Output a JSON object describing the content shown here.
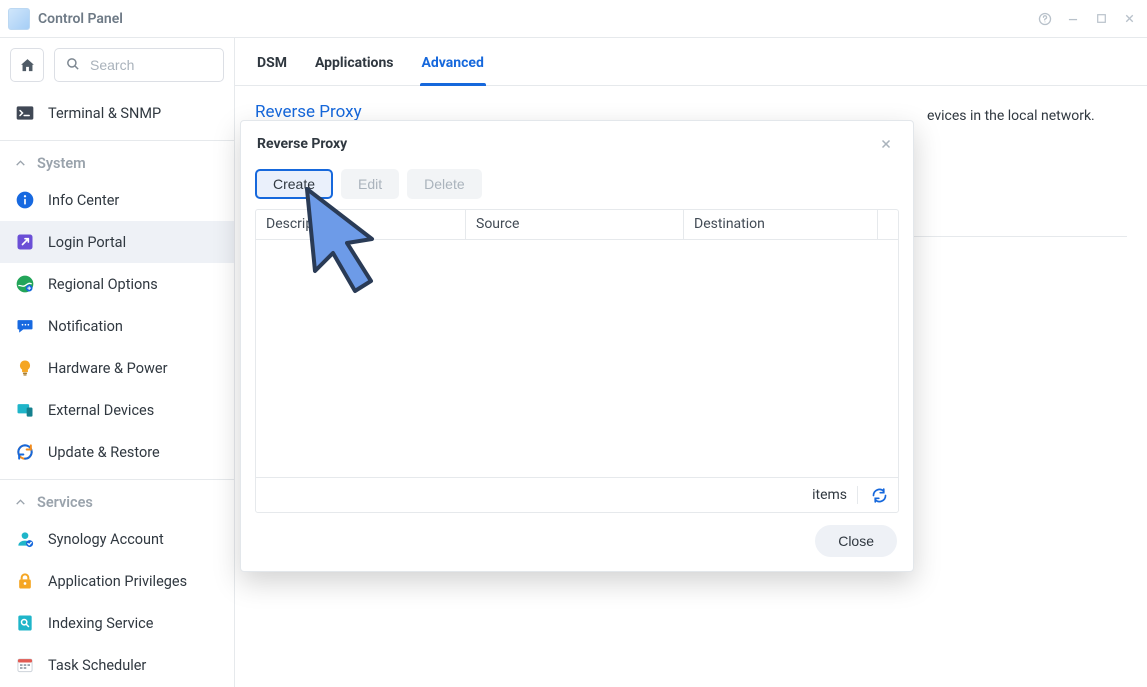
{
  "window": {
    "title": "Control Panel"
  },
  "sidebar": {
    "search_placeholder": "Search",
    "item_terminal": "Terminal & SNMP",
    "group_system": "System",
    "items_system": {
      "info_center": "Info Center",
      "login_portal": "Login Portal",
      "regional_options": "Regional Options",
      "notification": "Notification",
      "hardware_power": "Hardware & Power",
      "external_devices": "External Devices",
      "update_restore": "Update & Restore"
    },
    "group_services": "Services",
    "items_services": {
      "synology_account": "Synology Account",
      "application_privileges": "Application Privileges",
      "indexing_service": "Indexing Service",
      "task_scheduler": "Task Scheduler"
    }
  },
  "tabs": {
    "dsm": "DSM",
    "applications": "Applications",
    "advanced": "Advanced"
  },
  "section": {
    "heading": "Reverse Proxy",
    "desc_tail": "evices in the local network."
  },
  "dialog": {
    "title": "Reverse Proxy",
    "btn_create": "Create",
    "btn_edit": "Edit",
    "btn_delete": "Delete",
    "col_description": "Description",
    "col_source": "Source",
    "col_destination": "Destination",
    "status_items": "items",
    "btn_close": "Close"
  }
}
